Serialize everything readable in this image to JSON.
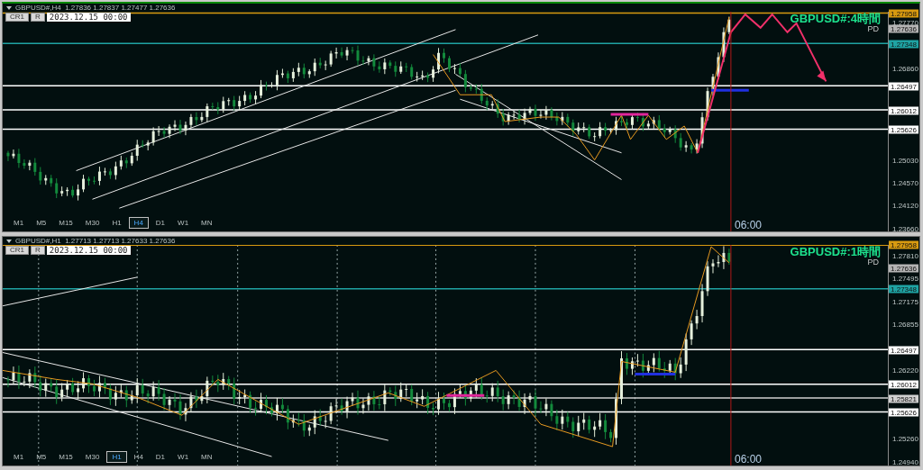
{
  "panes": [
    {
      "header": "GBPUSD#,H4  1.27836 1.27837 1.27477 1.27636",
      "buttons": [
        "CR1",
        "R"
      ],
      "date": "2023.12.15 00:00",
      "title": "GBPUSD#:4時間",
      "subtitle": "PD",
      "time_label": "06:00",
      "timeframes": [
        {
          "label": "M1",
          "selected": false
        },
        {
          "label": "M5",
          "selected": false
        },
        {
          "label": "M15",
          "selected": false
        },
        {
          "label": "M30",
          "selected": false
        },
        {
          "label": "H1",
          "selected": false
        },
        {
          "label": "H4",
          "selected": true
        },
        {
          "label": "D1",
          "selected": false
        },
        {
          "label": "W1",
          "selected": false
        },
        {
          "label": "MN",
          "selected": false
        }
      ],
      "axis_ticks": [
        "1.27770",
        "1.26860",
        "1.25030",
        "1.24570",
        "1.24120",
        "1.23660"
      ],
      "price_tags": [
        {
          "text": "1.27958",
          "kind": "level",
          "color": "#d89a10"
        },
        {
          "text": "1.27636",
          "kind": "bid",
          "color": "#b4b4b4"
        },
        {
          "text": "1.27348",
          "kind": "level",
          "color": "#1fa3a3"
        },
        {
          "text": "1.26497",
          "kind": "level",
          "color": "#ffffff"
        },
        {
          "text": "1.26012",
          "kind": "level",
          "color": "#ffffff"
        },
        {
          "text": "1.25626",
          "kind": "level",
          "color": "#ffffff"
        }
      ]
    },
    {
      "header": "GBPUSD#,H1  1.27713 1.27713 1.27633 1.27636",
      "buttons": [
        "CR1",
        "R"
      ],
      "date": "2023.12.15 00:00",
      "title": "GBPUSD#:1時間",
      "subtitle": "PD",
      "time_label": "06:00",
      "timeframes": [
        {
          "label": "M1",
          "selected": false
        },
        {
          "label": "M5",
          "selected": false
        },
        {
          "label": "M15",
          "selected": false
        },
        {
          "label": "M30",
          "selected": false
        },
        {
          "label": "H1",
          "selected": true
        },
        {
          "label": "H4",
          "selected": false
        },
        {
          "label": "D1",
          "selected": false
        },
        {
          "label": "W1",
          "selected": false
        },
        {
          "label": "MN",
          "selected": false
        }
      ],
      "axis_ticks": [
        "1.27810",
        "1.27495",
        "1.27175",
        "1.26855",
        "1.26220",
        "1.25260",
        "1.24940"
      ],
      "price_tags": [
        {
          "text": "1.27958",
          "kind": "level",
          "color": "#d89a10"
        },
        {
          "text": "1.27636",
          "kind": "bid",
          "color": "#b4b4b4"
        },
        {
          "text": "1.27348",
          "kind": "level",
          "color": "#1fa3a3"
        },
        {
          "text": "1.26497",
          "kind": "level",
          "color": "#ffffff"
        },
        {
          "text": "1.26012",
          "kind": "level",
          "color": "#ffffff"
        },
        {
          "text": "1.25821",
          "kind": "level",
          "color": "#d0d0d0"
        },
        {
          "text": "1.25626",
          "kind": "level",
          "color": "#ffffff"
        }
      ]
    }
  ]
}
